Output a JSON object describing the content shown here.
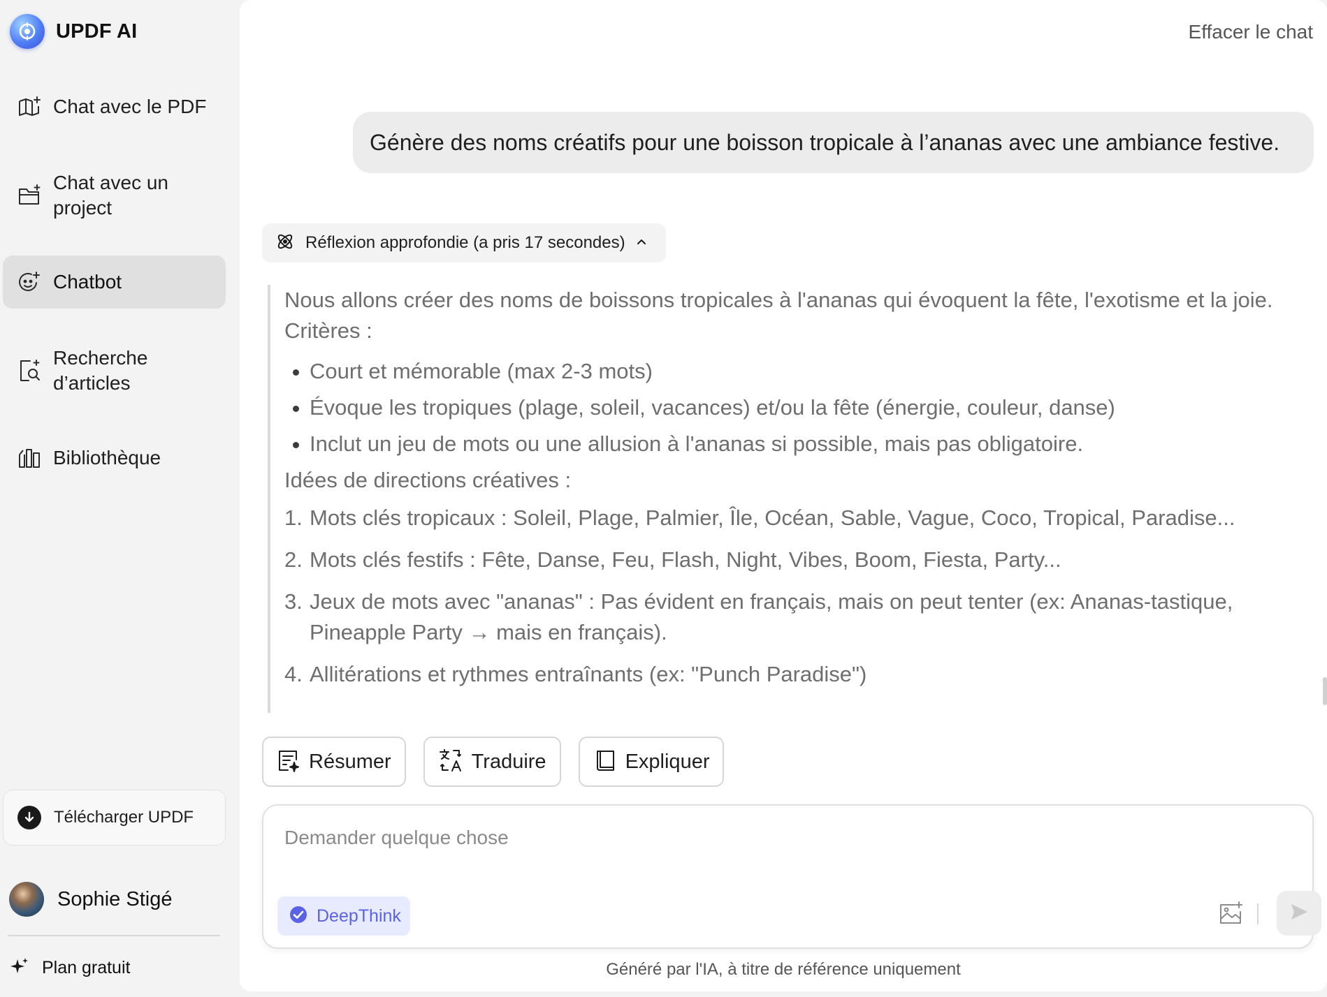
{
  "app": {
    "name": "UPDF AI"
  },
  "sidebar": {
    "items": [
      {
        "label": "Chat avec le PDF",
        "icon": "book-sparkle-icon"
      },
      {
        "label_line1": "Chat avec un",
        "label_line2": "project",
        "icon": "folder-sparkle-icon"
      },
      {
        "label": "Chatbot",
        "icon": "chatbot-face-icon",
        "active": true
      },
      {
        "label_line1": "Recherche",
        "label_line2": "d’articles",
        "icon": "search-document-icon"
      },
      {
        "label": "Bibliothèque",
        "icon": "library-books-icon"
      }
    ],
    "download": {
      "label": "Télécharger UPDF",
      "icon": "download-icon"
    },
    "user": {
      "name": "Sophie Stigé"
    },
    "plan": {
      "label": "Plan gratuit",
      "icon": "sparkle-icon"
    }
  },
  "header": {
    "clear_chat": "Effacer le chat"
  },
  "conversation": {
    "user_message": "Génère des noms créatifs pour une boisson tropicale à l’ananas avec une ambiance festive.",
    "thinking": {
      "label": "Réflexion approfondie (a pris 17 secondes)",
      "icon": "atom-icon",
      "chevron": "chevron-up-icon"
    },
    "reasoning": {
      "intro": "Nous allons créer des noms de boissons tropicales à l'ananas qui évoquent la fête, l'exotisme et la joie.",
      "criteria_title": "Critères :",
      "criteria": [
        "Court et mémorable (max 2-3 mots)",
        "Évoque les tropiques (plage, soleil, vacances) et/ou la fête (énergie, couleur, danse)",
        "Inclut un jeu de mots ou une allusion à l'ananas si possible, mais pas obligatoire."
      ],
      "ideas_title": "Idées de directions créatives :",
      "ideas": [
        {
          "num": "1.",
          "text": "Mots clés tropicaux : Soleil, Plage, Palmier, Île, Océan, Sable, Vague, Coco, Tropical, Paradise..."
        },
        {
          "num": "2.",
          "text": "Mots clés festifs : Fête, Danse, Feu, Flash, Night, Vibes, Boom, Fiesta, Party..."
        },
        {
          "num": "3.",
          "text": "Jeux de mots avec \"ananas\" : Pas évident en français, mais on peut tenter (ex: Ananas-tastique, Pineapple Party → mais en français)."
        },
        {
          "num": "4.",
          "text": "Allitérations et rythmes entraînants (ex: \"Punch Paradise\")"
        }
      ]
    }
  },
  "actions": [
    {
      "label": "Résumer",
      "icon": "summarize-icon"
    },
    {
      "label": "Traduire",
      "icon": "translate-icon"
    },
    {
      "label": "Expliquer",
      "icon": "book-icon"
    }
  ],
  "composer": {
    "placeholder": "Demander quelque chose",
    "deepthink_label": "DeepThink",
    "image_icon": "image-upload-icon",
    "send_icon": "send-icon"
  },
  "footer": {
    "disclaimer": "Généré par l'IA, à titre de référence uniquement"
  },
  "colors": {
    "accent": "#5a63e6",
    "deepthink_bg": "#e8ebfe",
    "active_nav": "#e0e0e0"
  }
}
